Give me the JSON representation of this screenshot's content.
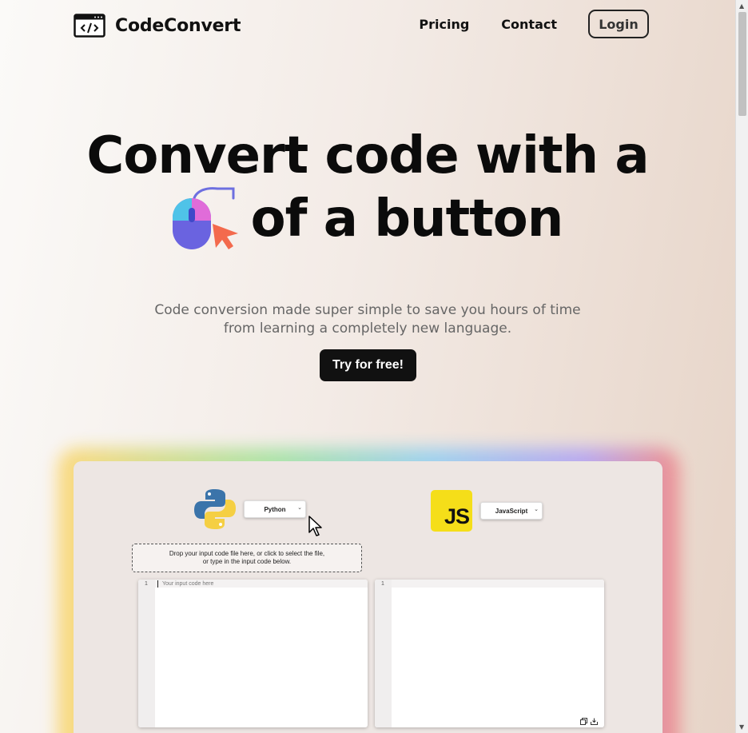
{
  "header": {
    "brand": "CodeConvert",
    "logo_icon": "code-window-icon",
    "nav": {
      "pricing": "Pricing",
      "contact": "Contact"
    },
    "login_label": "Login"
  },
  "hero": {
    "line1": "Convert code with a",
    "line2": "of a button",
    "inline_icon": "mouse-click-icon",
    "subtitle_line1": "Code conversion made super simple to save you hours of time",
    "subtitle_line2": "from learning a completely new language.",
    "cta_label": "Try for free!"
  },
  "demo": {
    "source": {
      "icon": "python-logo-icon",
      "language": "Python"
    },
    "target": {
      "icon": "javascript-logo-icon",
      "logo_text": "JS",
      "language": "JavaScript"
    },
    "drop_zone": {
      "line1": "Drop your input code file here, or click to select the file,",
      "line2": "or type in the input code below."
    },
    "input_editor": {
      "line_number": "1",
      "placeholder": "Your input code here"
    },
    "output_editor": {
      "line_number": "1",
      "tools": [
        "copy-icon",
        "download-icon"
      ]
    }
  },
  "colors": {
    "cta_background": "#111111",
    "js_yellow": "#f5de19",
    "frame_background": "#ede6e3"
  }
}
